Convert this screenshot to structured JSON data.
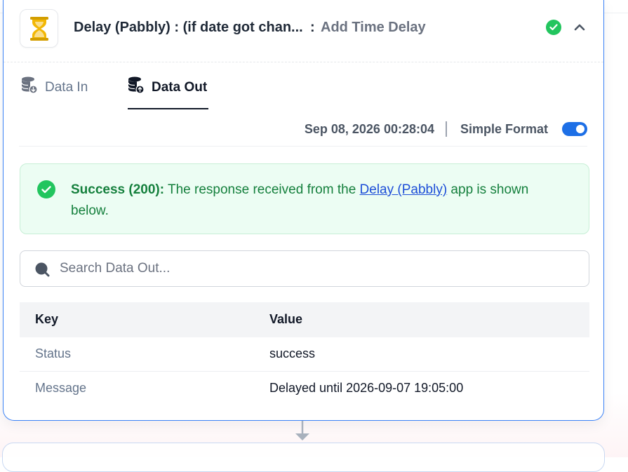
{
  "header": {
    "title": "Delay (Pabbly) : (if date got chan...",
    "separator": ":",
    "subtitle": "Add Time Delay",
    "app_icon": "hourglass-icon",
    "status_icon": "check-circle-icon",
    "collapse_icon": "chevron-up-icon"
  },
  "tabs": [
    {
      "label": "Data In",
      "icon": "database-download-icon",
      "active": false
    },
    {
      "label": "Data Out",
      "icon": "database-upload-icon",
      "active": true
    }
  ],
  "meta": {
    "timestamp": "Sep 08, 2026 00:28:04",
    "format_label": "Simple Format",
    "format_enabled": true
  },
  "success": {
    "prefix": "Success (200):",
    "text_before_link": " The response received from the ",
    "link_text": "Delay (Pabbly)",
    "text_after_link": " app is shown below."
  },
  "search": {
    "placeholder": "Search Data Out...",
    "value": ""
  },
  "table": {
    "headers": {
      "key": "Key",
      "value": "Value"
    },
    "rows": [
      {
        "key": "Status",
        "value": "success"
      },
      {
        "key": "Message",
        "value": "Delayed until 2026-09-07 19:05:00"
      }
    ]
  },
  "colors": {
    "accent": "#3b82f6",
    "success": "#22c55e",
    "toggle": "#1d6fe6",
    "hourglass": "#eab308"
  }
}
